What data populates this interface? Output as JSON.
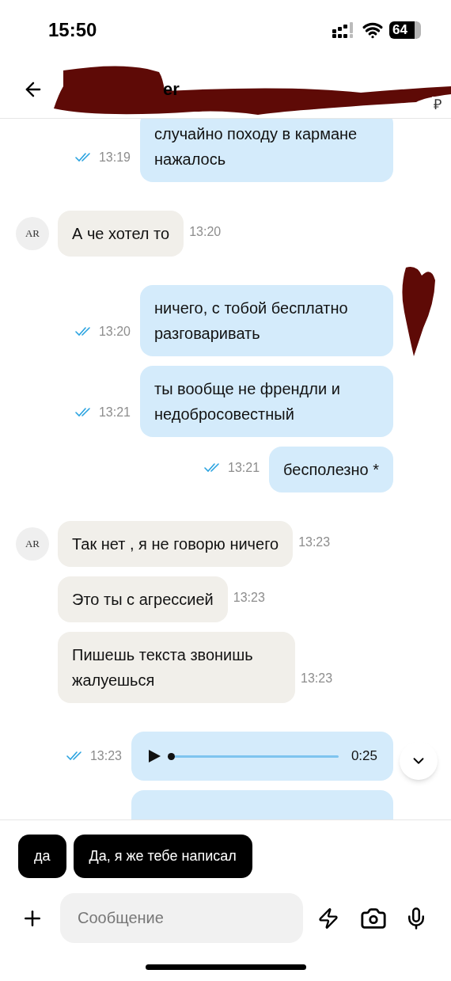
{
  "status_bar": {
    "time": "15:50",
    "battery": "64"
  },
  "header": {
    "title_fragment": "er",
    "subtitle_fragment": "₽"
  },
  "groups": [
    {
      "outgoing": true,
      "messages": [
        {
          "kind": "text",
          "text": "случайно походу в кармане нажалось",
          "time": "13:19",
          "read": true
        }
      ]
    },
    {
      "outgoing": false,
      "avatar": "AR",
      "messages": [
        {
          "kind": "text",
          "text": "А че хотел то",
          "time": "13:20"
        }
      ]
    },
    {
      "outgoing": true,
      "messages": [
        {
          "kind": "text",
          "text": "ничего, с тобой бесплатно разговаривать",
          "time": "13:20",
          "read": true
        },
        {
          "kind": "text",
          "text": "ты вообще не френдли и недобросовестный",
          "time": "13:21",
          "read": true
        },
        {
          "kind": "text",
          "text": "бесполезно *",
          "time": "13:21",
          "read": true
        }
      ]
    },
    {
      "outgoing": false,
      "avatar": "AR",
      "messages": [
        {
          "kind": "text",
          "text": "Так нет , я не говорю ничего",
          "time": "13:23"
        },
        {
          "kind": "text",
          "text": "Это ты с агрессией",
          "time": "13:23"
        },
        {
          "kind": "text",
          "text": "Пишешь текста звонишь жалуешься",
          "time": "13:23"
        }
      ]
    },
    {
      "outgoing": true,
      "messages": [
        {
          "kind": "voice",
          "duration": "0:25",
          "level": 0,
          "time": "13:23",
          "read": true
        },
        {
          "kind": "partial"
        }
      ]
    }
  ],
  "quick_replies": [
    "да",
    "Да, я же тебе написал"
  ],
  "composer": {
    "placeholder": "Сообщение"
  }
}
